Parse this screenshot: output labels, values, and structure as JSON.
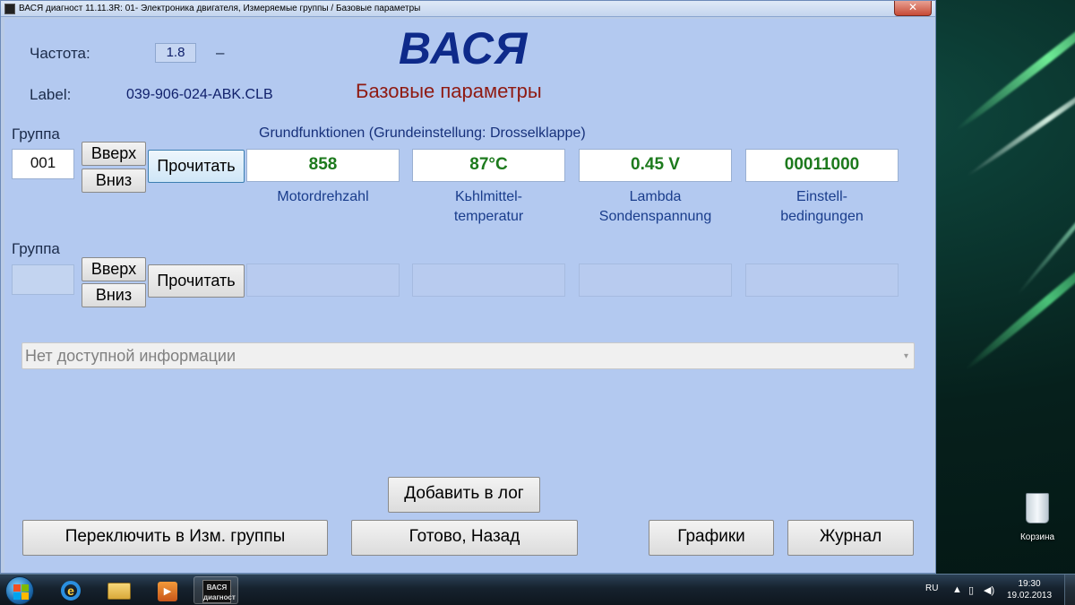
{
  "window": {
    "title": "ВАСЯ диагност 11.11.3R: 01- Электроника двигателя,  Измеряемые группы / Базовые параметры",
    "close_glyph": "✕"
  },
  "header": {
    "freq_label": "Частота:",
    "freq_value": "1.8",
    "freq_dash": "–",
    "label_label": "Label:",
    "label_value": "039-906-024-ABK.CLB",
    "brand": "ВАСЯ",
    "subtitle": "Базовые параметры"
  },
  "group1": {
    "label": "Группа",
    "number": "001",
    "up_label": "Вверх",
    "down_label": "Вниз",
    "read_label": "Прочитать",
    "description": "Grundfunktionen (Grundeinstellung: Drosselklappe)",
    "fields": [
      {
        "value": "858",
        "caption_1": "Motordrehzahl",
        "caption_2": ""
      },
      {
        "value": "87°C",
        "caption_1": "Kьhlmittel-",
        "caption_2": "temperatur"
      },
      {
        "value": "0.45 V",
        "caption_1": "Lambda",
        "caption_2": "Sondenspannung"
      },
      {
        "value": "00011000",
        "caption_1": "Einstell-",
        "caption_2": "bedingungen"
      }
    ]
  },
  "group2": {
    "label": "Группа",
    "number": "",
    "up_label": "Вверх",
    "down_label": "Вниз",
    "read_label": "Прочитать"
  },
  "info_select": {
    "value": "Нет доступной информации",
    "arrow": "▾"
  },
  "buttons": {
    "add_to_log": "Добавить в лог",
    "switch_groups": "Переключить в Изм. группы",
    "done_back": "Готово, Назад",
    "graphs": "Графики",
    "journal": "Журнал"
  },
  "desktop": {
    "recycle_bin_label": "Корзина"
  },
  "taskbar": {
    "ie_glyph": "e",
    "player_glyph": "▶",
    "vasya_app_label_1": "ВАСЯ",
    "vasya_app_label_2": "диагност",
    "language": "RU",
    "tray_arrow": "▲",
    "tray_battery": "▯",
    "tray_volume": "◀)",
    "time": "19:30",
    "date": "19.02.2013"
  },
  "colors": {
    "window_bg": "#b3c9f0",
    "brand": "#0e2a8a",
    "subtitle": "#8f1a12",
    "value_green": "#1d7a1d",
    "caption_blue": "#1a3d8c"
  }
}
